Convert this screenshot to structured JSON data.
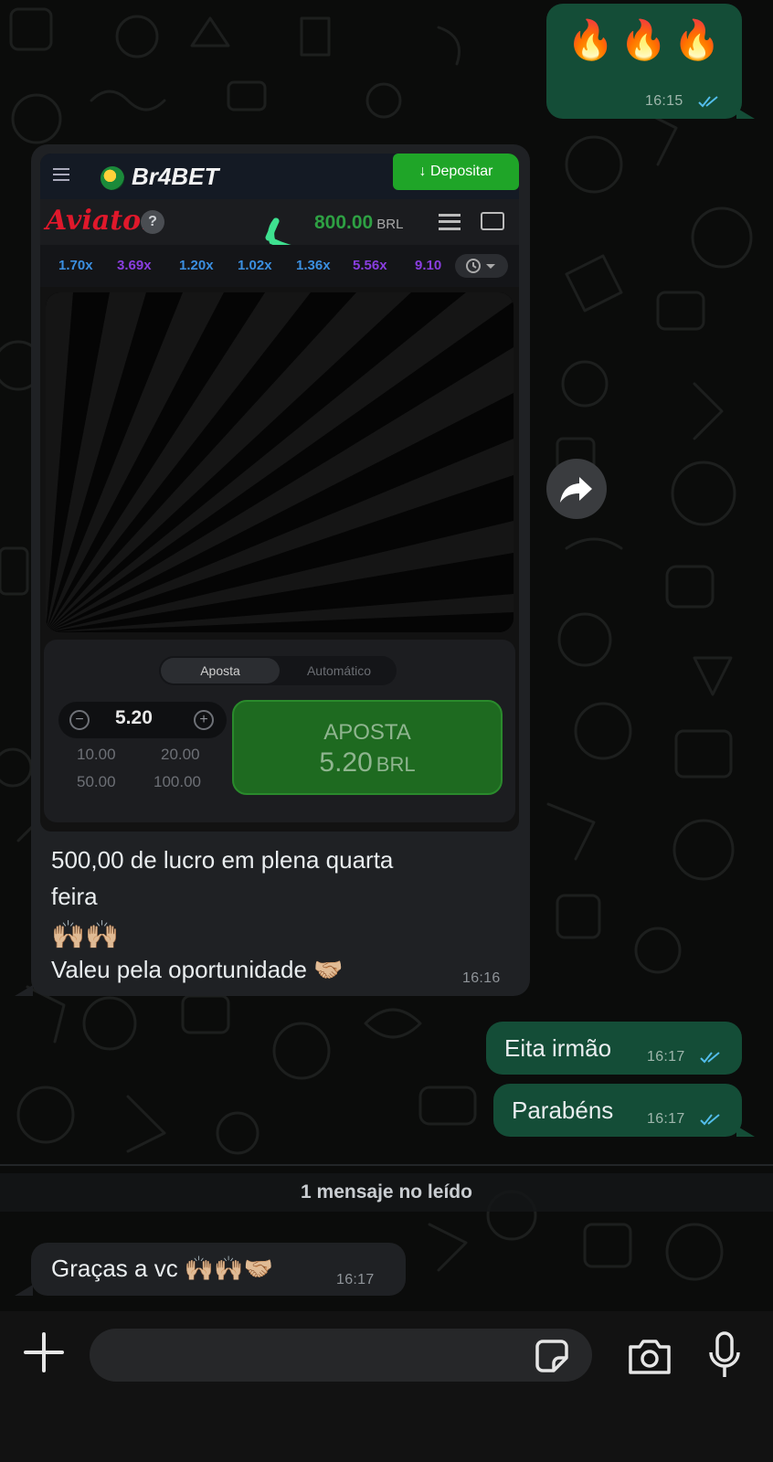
{
  "messages": [
    {
      "id": "m1",
      "direction": "outgoing",
      "text": "🔥🔥🔥",
      "time": "16:15",
      "read": true
    },
    {
      "id": "m2",
      "direction": "incoming",
      "type": "image",
      "caption_lines": [
        "500,00 de lucro em plena quarta",
        "feira",
        "🙌🏼🙌🏼",
        "Valeu pela oportunidade 🤝🏼"
      ],
      "time": "16:16"
    },
    {
      "id": "m3",
      "direction": "outgoing",
      "text": "Eita irmão",
      "time": "16:17",
      "read": true
    },
    {
      "id": "m4",
      "direction": "outgoing",
      "text": "Parabéns",
      "time": "16:17",
      "read": true
    },
    {
      "id": "m5",
      "direction": "incoming",
      "text": "Graças a vc 🙌🏼🙌🏼🤝🏼",
      "time": "16:17"
    }
  ],
  "unread_divider": "1 mensaje no leído",
  "game_screenshot": {
    "brand": "Br4BET",
    "deposit_label": "↓ Depositar",
    "game_title": "Aviator",
    "help": "?",
    "balance": "800.00",
    "currency": "BRL",
    "multipliers": [
      {
        "value": "1.70x",
        "color": "#3b8fe0"
      },
      {
        "value": "3.69x",
        "color": "#8a3ee0"
      },
      {
        "value": "1.20x",
        "color": "#3b8fe0"
      },
      {
        "value": "1.02x",
        "color": "#3b8fe0"
      },
      {
        "value": "1.36x",
        "color": "#3b8fe0"
      },
      {
        "value": "5.56x",
        "color": "#8a3ee0"
      },
      {
        "value": "9.10",
        "color": "#8a3ee0"
      }
    ],
    "tab_active": "Aposta",
    "tab_other": "Automático",
    "stepper_value": "5.20",
    "quick_amounts": [
      "10.00",
      "20.00",
      "50.00",
      "100.00"
    ],
    "bet_label": "APOSTA",
    "bet_value": "5.20",
    "bet_currency": "BRL"
  },
  "composer": {
    "placeholder": ""
  },
  "icons": {
    "read_ticks": "double-check-icon",
    "forward": "forward-arrow-icon",
    "attach": "plus-icon",
    "sticker": "sticker-icon",
    "camera": "camera-icon",
    "mic": "microphone-icon"
  },
  "colors": {
    "outgoing_bubble": "#144d37",
    "incoming_bubble": "#1f2124",
    "read_tick": "#53bdeb",
    "background": "#0b0c0b",
    "highlight_stroke": "#3ee08f"
  }
}
